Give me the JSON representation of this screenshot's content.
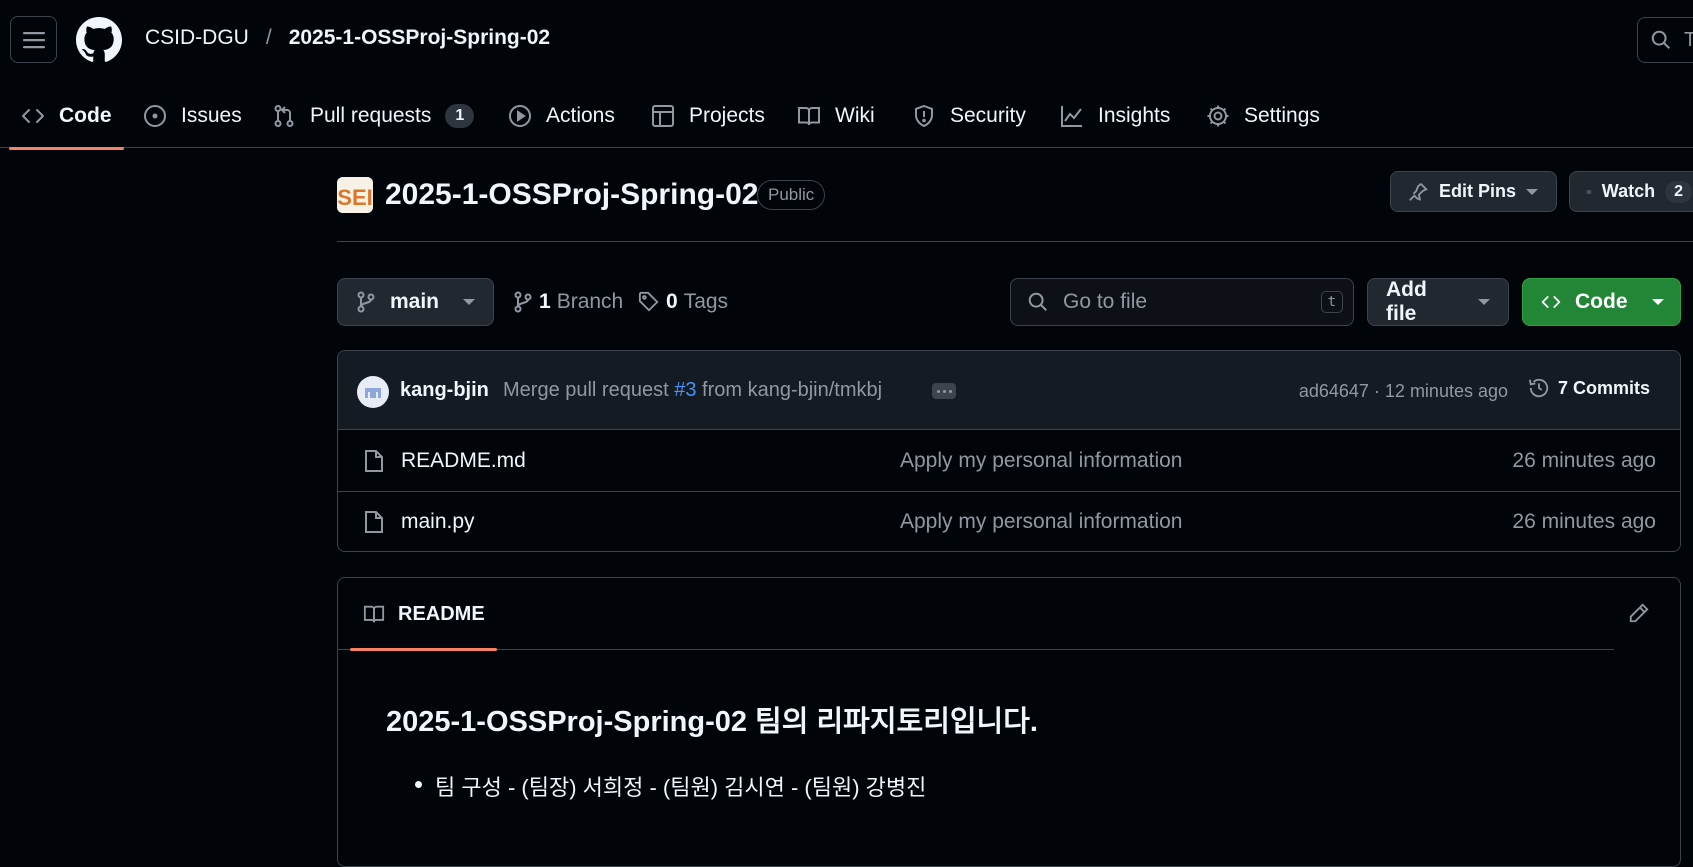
{
  "header": {
    "owner": "CSID-DGU",
    "separator": "/",
    "repo": "2025-1-OSSProj-Spring-02",
    "search_placeholder": "T"
  },
  "tabs": [
    {
      "label": "Code",
      "icon": "code-icon",
      "active": true
    },
    {
      "label": "Issues",
      "icon": "issue-icon"
    },
    {
      "label": "Pull requests",
      "icon": "pull-request-icon",
      "count": "1"
    },
    {
      "label": "Actions",
      "icon": "play-icon"
    },
    {
      "label": "Projects",
      "icon": "table-icon"
    },
    {
      "label": "Wiki",
      "icon": "book-icon"
    },
    {
      "label": "Security",
      "icon": "shield-icon"
    },
    {
      "label": "Insights",
      "icon": "graph-icon"
    },
    {
      "label": "Settings",
      "icon": "gear-icon"
    }
  ],
  "repo_header": {
    "avatar_text": "SEI",
    "title": "2025-1-OSSProj-Spring-02",
    "visibility": "Public",
    "edit_pins_label": "Edit Pins",
    "watch_label": "Watch",
    "watch_count": "2"
  },
  "toolbar": {
    "branch": "main",
    "branch_count": "1",
    "branch_label": "Branch",
    "tag_count": "0",
    "tag_label": "Tags",
    "goto_placeholder": "Go to file",
    "goto_shortcut": "t",
    "add_file_label": "Add file",
    "code_label": "Code"
  },
  "latest_commit": {
    "author": "kang-bjin",
    "message_prefix": "Merge pull request",
    "pr_ref": "#3",
    "message_suffix": "from kang-bjin/tmkbj",
    "sha_time": "ad64647 · 12 minutes ago",
    "commits_label": "7 Commits"
  },
  "files": [
    {
      "name": "README.md",
      "message": "Apply my personal information",
      "time": "26 minutes ago"
    },
    {
      "name": "main.py",
      "message": "Apply my personal information",
      "time": "26 minutes ago"
    }
  ],
  "readme": {
    "tab_label": "README",
    "heading": "2025-1-OSSProj-Spring-02 팀의 리파지토리입니다.",
    "items": [
      "팀 구성 - (팀장) 서희정 - (팀원) 김시연 - (팀원) 강병진"
    ]
  },
  "colors": {
    "background": "#010409",
    "accent_underline": "#f78166",
    "primary_button": "#238636",
    "link": "#4493f8"
  }
}
